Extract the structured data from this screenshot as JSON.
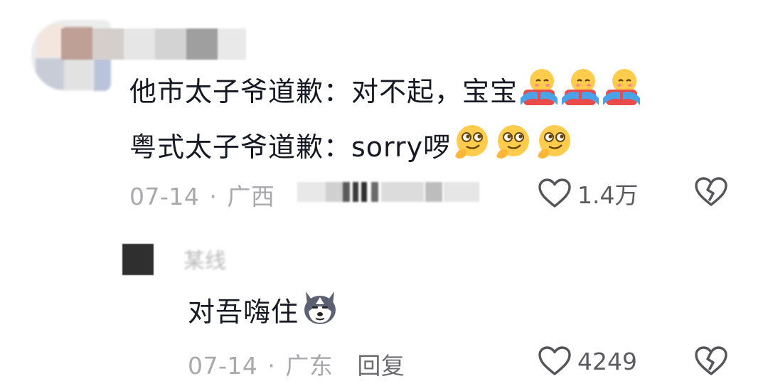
{
  "comments": [
    {
      "lines": [
        "他市太子爷道歉：对不起，宝宝",
        "粤式太子爷道歉：sorry啰"
      ],
      "emojis": [
        [
          "hug-emoji",
          "hug-emoji",
          "hug-emoji"
        ],
        [
          "smirk-emoji",
          "smirk-emoji",
          "smirk-emoji"
        ]
      ],
      "date": "07-14",
      "separator": "·",
      "location": "广西",
      "likes": "1.4万"
    }
  ],
  "reply": {
    "username": "某线",
    "text": "对吾嗨住",
    "emoji": "husky-emoji",
    "date": "07-14",
    "separator": "·",
    "location": "广东",
    "reply_label": "回复",
    "likes": "4249"
  },
  "colors": {
    "text": "#161823",
    "meta": "#a8a8ad",
    "reply_link": "#6c6c70",
    "background": "#ffffff"
  }
}
